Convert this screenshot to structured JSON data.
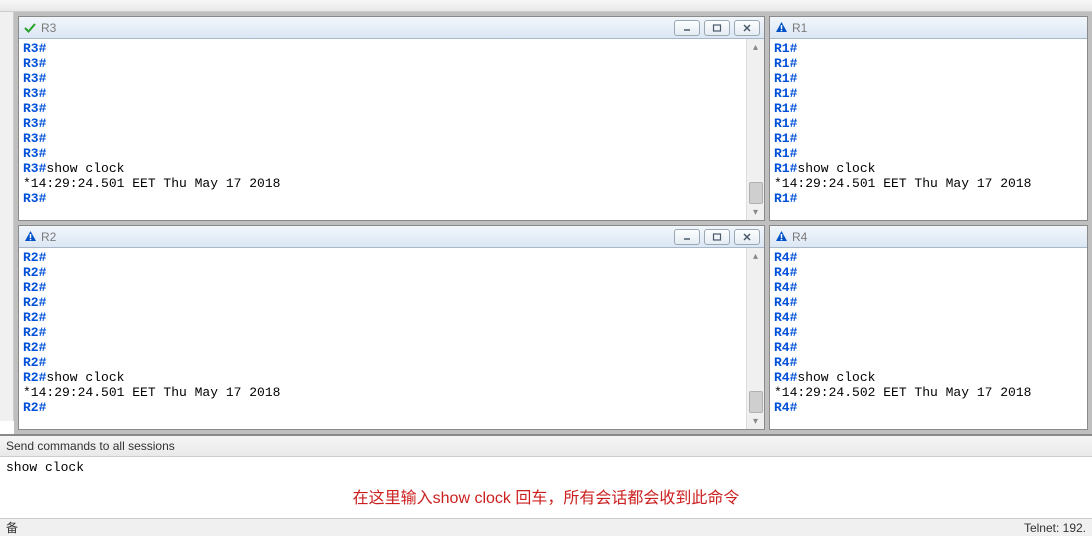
{
  "panes": {
    "r3": {
      "title": "R3",
      "status": "ok",
      "prompt": "R3#",
      "prompt_count": 8,
      "command": "show clock",
      "output": "*14:29:24.501 EET Thu May 17 2018",
      "show_win_controls": true
    },
    "r1": {
      "title": "R1",
      "status": "warn",
      "prompt": "R1#",
      "prompt_count": 8,
      "command": "show clock",
      "output": "*14:29:24.501 EET Thu May 17 2018",
      "show_win_controls": false
    },
    "r2": {
      "title": "R2",
      "status": "warn",
      "prompt": "R2#",
      "prompt_count": 8,
      "command": "show clock",
      "output": "*14:29:24.501 EET Thu May 17 2018",
      "show_win_controls": true
    },
    "r4": {
      "title": "R4",
      "status": "warn",
      "prompt": "R4#",
      "prompt_count": 8,
      "command": "show clock",
      "output": "*14:29:24.502 EET Thu May 17 2018",
      "show_win_controls": false
    }
  },
  "sendbar": {
    "label": "Send commands to all sessions",
    "value": "show clock"
  },
  "annotation": "在这里输入show clock 回车，所有会话都会收到此命令",
  "statusbar": {
    "left": "备",
    "right": "Telnet: 192."
  }
}
